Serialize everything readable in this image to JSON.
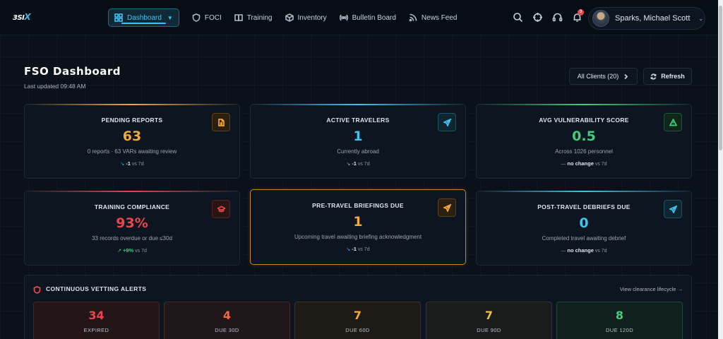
{
  "app": {
    "logo_text": "3SI",
    "logo_x": "X"
  },
  "nav": {
    "items": [
      {
        "label": "Dashboard",
        "icon": "dashboard-grid-icon",
        "active": true
      },
      {
        "label": "FOCI",
        "icon": "shield-icon"
      },
      {
        "label": "Training",
        "icon": "book-icon"
      },
      {
        "label": "Inventory",
        "icon": "cube-icon"
      },
      {
        "label": "Bulletin Board",
        "icon": "broadcast-icon"
      },
      {
        "label": "News Feed",
        "icon": "rss-icon"
      }
    ]
  },
  "user": {
    "name": "Sparks, Michael Scott",
    "notification_count": "3"
  },
  "header": {
    "title": "FSO Dashboard",
    "last_updated": "Last updated 09:48 AM",
    "clients_button": "All Clients (20)",
    "refresh_button": "Refresh"
  },
  "cards": [
    {
      "label": "PENDING REPORTS",
      "value": "63",
      "value_color": "#f0a93a",
      "sub": "0 reports · 63 VARs awaiting review",
      "trend_value": "-1",
      "trend_suffix": "vs 7d",
      "icon": "document-icon",
      "accent": "#f0a93a"
    },
    {
      "label": "ACTIVE TRAVELERS",
      "value": "1",
      "value_color": "#3fc3f0",
      "sub": "Currently abroad",
      "trend_value": "-1",
      "trend_suffix": "vs 7d",
      "icon": "plane-icon",
      "accent": "#3fc3f0"
    },
    {
      "label": "AVG VULNERABILITY SCORE",
      "value": "0.5",
      "value_color": "#3ecf7a",
      "sub": "Across 1026 personnel",
      "trend_value": "no change",
      "trend_suffix": "vs 7d",
      "icon": "warning-triangle-icon",
      "accent": "#3ecf7a"
    },
    {
      "label": "TRAINING COMPLIANCE",
      "value": "93%",
      "value_color": "#e5484d",
      "sub": "33 records overdue or due ≤30d",
      "trend_value": "+9%",
      "trend_suffix": "vs 7d",
      "icon": "graduation-cap-icon",
      "accent": "#e5484d"
    },
    {
      "label": "PRE-TRAVEL BRIEFINGS DUE",
      "value": "1",
      "value_color": "#f0a93a",
      "sub": "Upcoming travel awaiting briefing acknowledgment",
      "trend_value": "-1",
      "trend_suffix": "vs 7d",
      "icon": "plane-icon",
      "accent": "#f0a93a"
    },
    {
      "label": "POST-TRAVEL DEBRIEFS DUE",
      "value": "0",
      "value_color": "#3fc3f0",
      "sub": "Completed travel awaiting debrief",
      "trend_value": "no change",
      "trend_suffix": "vs 7d",
      "icon": "plane-icon",
      "accent": "#3fc3f0"
    }
  ],
  "vetting": {
    "title": "CONTINUOUS VETTING ALERTS",
    "link": "View clearance lifecycle →",
    "boxes": [
      {
        "value": "34",
        "label": "EXPIRED",
        "color": "#e5484d",
        "bg": "#241519",
        "border": "#4a2126"
      },
      {
        "value": "4",
        "label": "DUE 30D",
        "color": "#f06a4a",
        "bg": "#1f171a",
        "border": "#3e2a2a"
      },
      {
        "value": "7",
        "label": "DUE 60D",
        "color": "#f0a93a",
        "bg": "#1e1b17",
        "border": "#3b3323"
      },
      {
        "value": "7",
        "label": "DUE 90D",
        "color": "#e8c24a",
        "bg": "#191c1a",
        "border": "#2f3428"
      },
      {
        "value": "8",
        "label": "DUE 120D",
        "color": "#3ecf7a",
        "bg": "#10201c",
        "border": "#1f4536"
      }
    ]
  }
}
